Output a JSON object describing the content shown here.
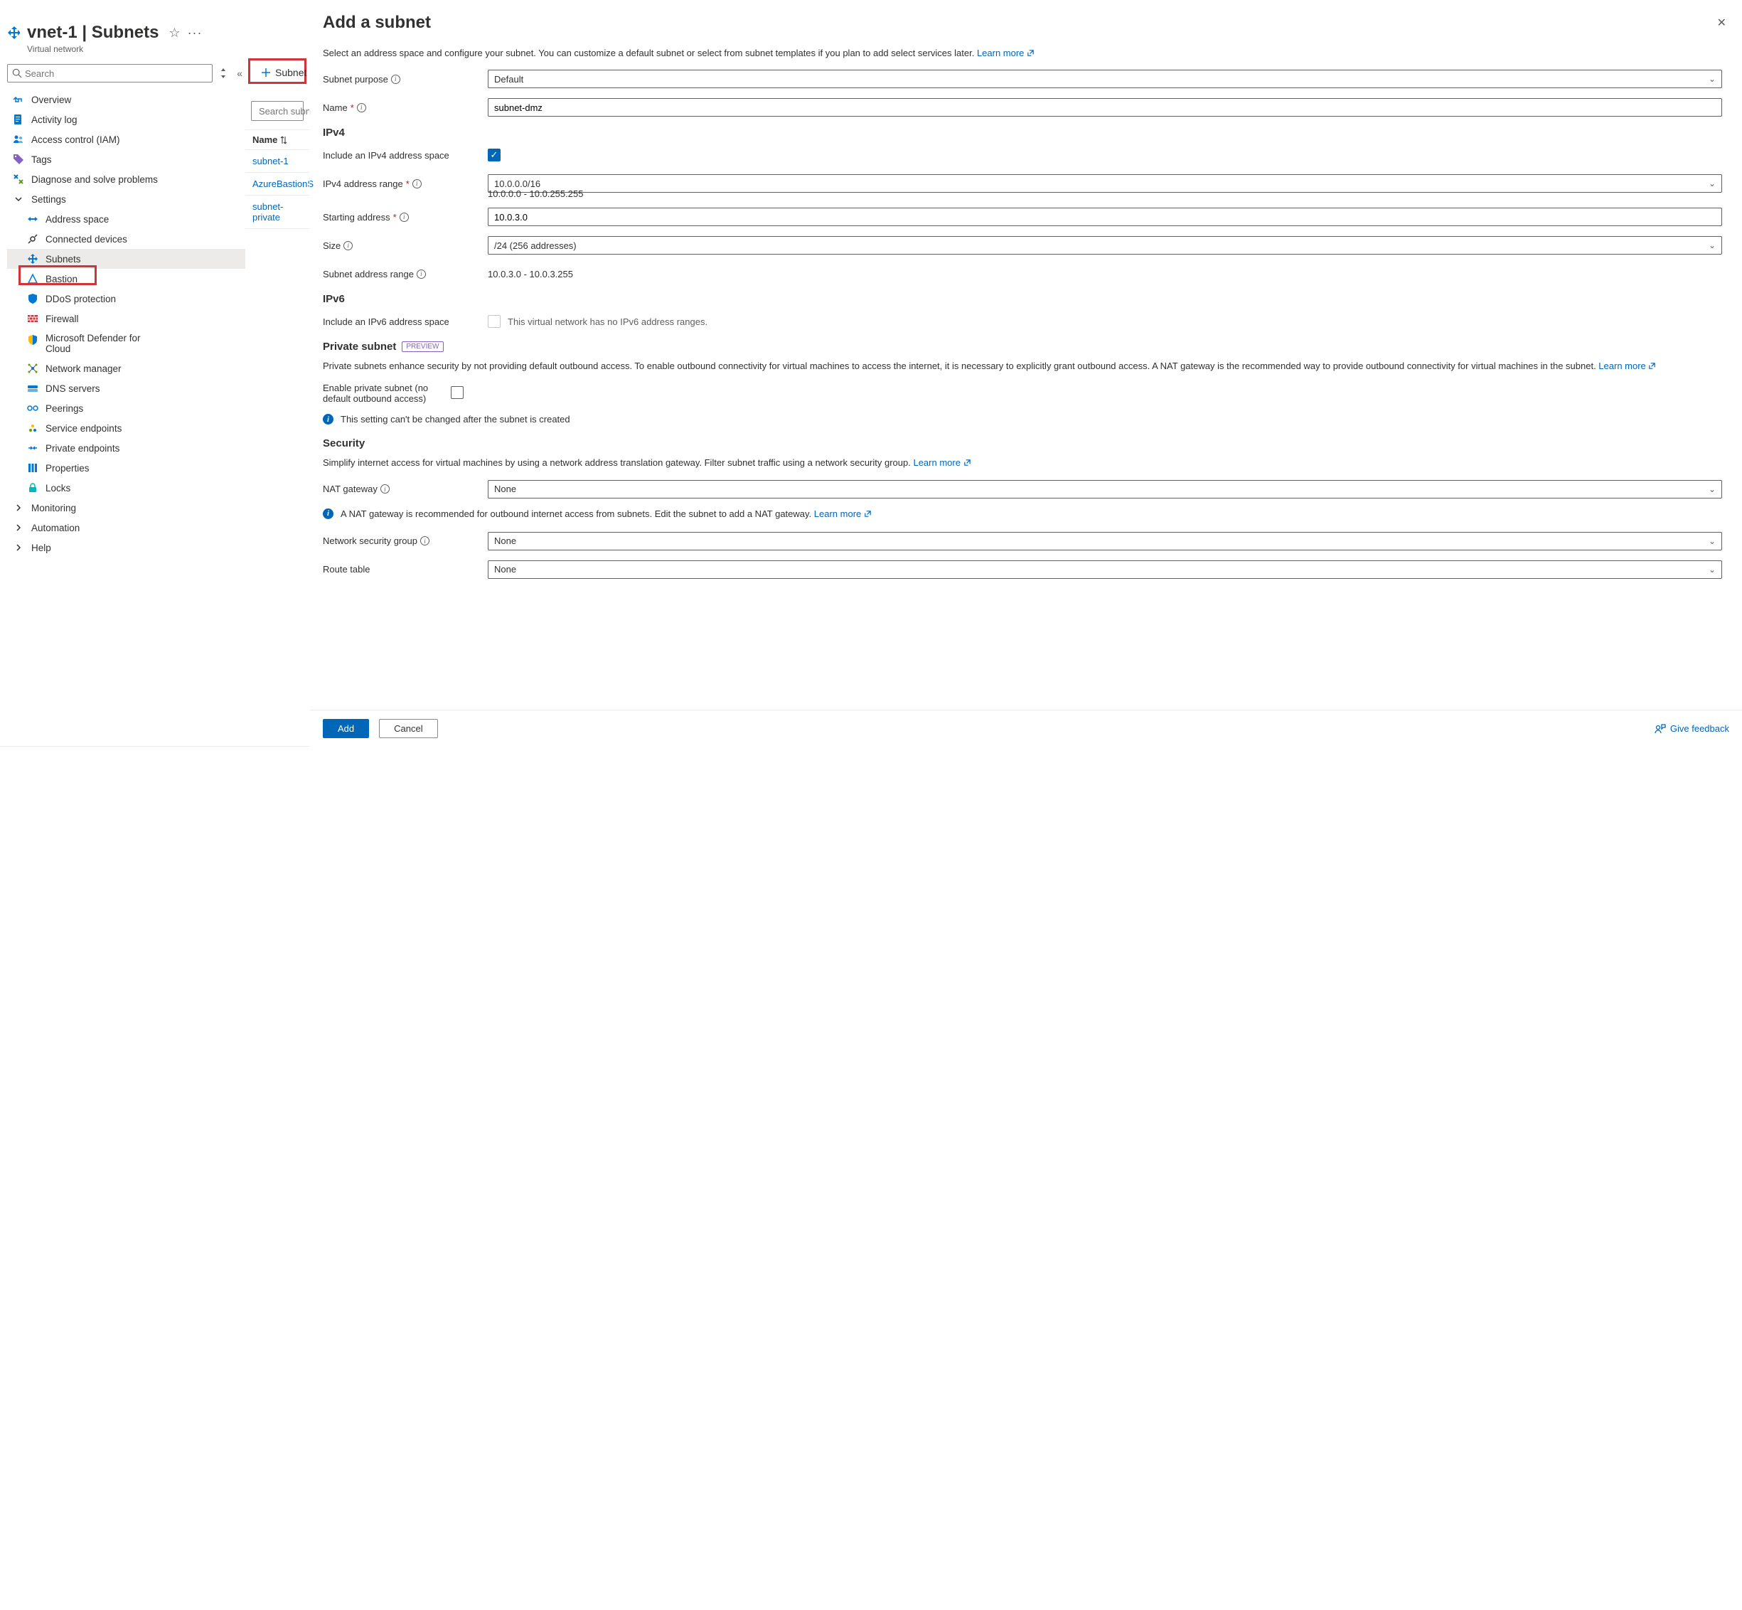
{
  "header": {
    "title": "vnet-1 | Subnets",
    "subtitle": "Virtual network",
    "search_placeholder": "Search"
  },
  "sidebar": {
    "items": [
      {
        "label": "Overview"
      },
      {
        "label": "Activity log"
      },
      {
        "label": "Access control (IAM)"
      },
      {
        "label": "Tags"
      },
      {
        "label": "Diagnose and solve problems"
      }
    ],
    "settings_label": "Settings",
    "settings": [
      {
        "label": "Address space"
      },
      {
        "label": "Connected devices"
      },
      {
        "label": "Subnets"
      },
      {
        "label": "Bastion"
      },
      {
        "label": "DDoS protection"
      },
      {
        "label": "Firewall"
      },
      {
        "label": "Microsoft Defender for Cloud"
      },
      {
        "label": "Network manager"
      },
      {
        "label": "DNS servers"
      },
      {
        "label": "Peerings"
      },
      {
        "label": "Service endpoints"
      },
      {
        "label": "Private endpoints"
      },
      {
        "label": "Properties"
      },
      {
        "label": "Locks"
      }
    ],
    "footer": [
      {
        "label": "Monitoring"
      },
      {
        "label": "Automation"
      },
      {
        "label": "Help"
      }
    ]
  },
  "middle": {
    "add_subnet_label": "Subnet",
    "search_placeholder": "Search subn",
    "col_name": "Name",
    "rows": [
      "subnet-1",
      "AzureBastionS",
      "subnet-private"
    ]
  },
  "panel": {
    "title": "Add a subnet",
    "intro_text": "Select an address space and configure your subnet. You can customize a default subnet or select from subnet templates if you plan to add select services later.  ",
    "learn_more": "Learn more",
    "purpose_label": "Subnet purpose",
    "purpose_value": "Default",
    "name_label": "Name",
    "name_value": "subnet-dmz",
    "ipv4_heading": "IPv4",
    "include_v4_label": "Include an IPv4 address space",
    "v4_range_label": "IPv4 address range",
    "v4_range_value": "10.0.0.0/16",
    "v4_range_helper": "10.0.0.0 - 10.0.255.255",
    "start_label": "Starting address",
    "start_value": "10.0.3.0",
    "size_label": "Size",
    "size_value": "/24 (256 addresses)",
    "subnet_range_label": "Subnet address range",
    "subnet_range_value": "10.0.3.0 - 10.0.3.255",
    "ipv6_heading": "IPv6",
    "include_v6_label": "Include an IPv6 address space",
    "v6_note": "This virtual network has no IPv6 address ranges.",
    "private_heading": "Private subnet",
    "preview_badge": "PREVIEW",
    "private_desc": "Private subnets enhance security by not providing default outbound access. To enable outbound connectivity for virtual machines to access the internet, it is necessary to explicitly grant outbound access. A NAT gateway is the recommended way to provide outbound connectivity for virtual machines in the subnet.  ",
    "enable_private_label": "Enable private subnet (no default outbound access)",
    "private_info": "This setting can't be changed after the subnet is created",
    "security_heading": "Security",
    "security_desc": "Simplify internet access for virtual machines by using a network address translation gateway. Filter subnet traffic using a network security group. ",
    "nat_label": "NAT gateway",
    "nat_value": "None",
    "nat_info": "A NAT gateway is recommended for outbound internet access from subnets. Edit the subnet to add a NAT gateway.  ",
    "nsg_label": "Network security group",
    "nsg_value": "None",
    "route_label": "Route table",
    "route_value": "None",
    "add_btn": "Add",
    "cancel_btn": "Cancel",
    "feedback": "Give feedback"
  }
}
